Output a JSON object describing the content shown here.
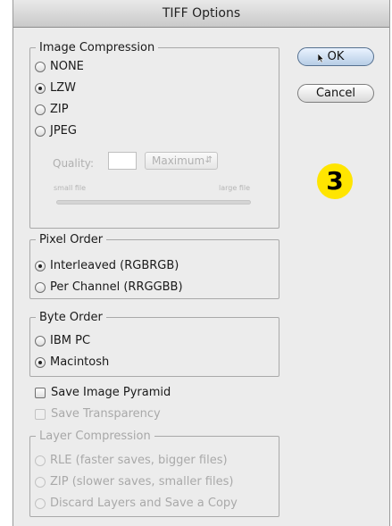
{
  "window": {
    "title": "TIFF Options"
  },
  "image_compression": {
    "legend": "Image Compression",
    "options": [
      {
        "label": "NONE",
        "selected": false
      },
      {
        "label": "LZW",
        "selected": true
      },
      {
        "label": "ZIP",
        "selected": false
      },
      {
        "label": "JPEG",
        "selected": false
      }
    ],
    "quality_label": "Quality:",
    "quality_value": "",
    "quality_select": "Maximum",
    "small_file_label": "small file",
    "large_file_label": "large file"
  },
  "pixel_order": {
    "legend": "Pixel Order",
    "options": [
      {
        "label": "Interleaved (RGBRGB)",
        "selected": true
      },
      {
        "label": "Per Channel (RRGGBB)",
        "selected": false
      }
    ]
  },
  "byte_order": {
    "legend": "Byte Order",
    "options": [
      {
        "label": "IBM PC",
        "selected": false
      },
      {
        "label": "Macintosh",
        "selected": true
      }
    ]
  },
  "checkboxes": {
    "save_image_pyramid": "Save Image Pyramid",
    "save_transparency": "Save Transparency"
  },
  "layer_compression": {
    "legend": "Layer Compression",
    "options": [
      {
        "label": "RLE (faster saves, bigger files)",
        "selected": false
      },
      {
        "label": "ZIP (slower saves, smaller files)",
        "selected": false
      },
      {
        "label": "Discard Layers and Save a Copy",
        "selected": false
      }
    ]
  },
  "buttons": {
    "ok": "OK",
    "cancel": "Cancel"
  },
  "badge": {
    "number": "3",
    "color": "#ffe500"
  }
}
